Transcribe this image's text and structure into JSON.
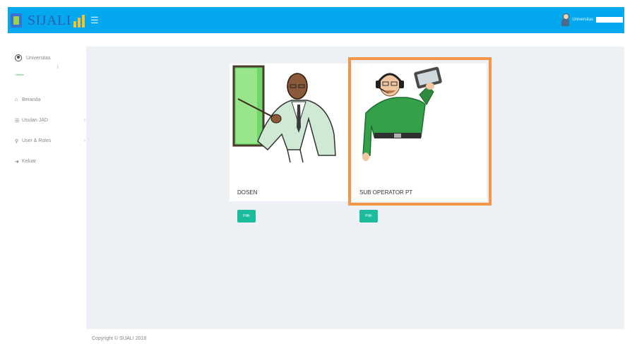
{
  "app": {
    "logo_text": "SIJALI"
  },
  "topbar": {
    "menu_icon": "hamburger-icon",
    "user_name": "Universitas"
  },
  "sidebar": {
    "user": {
      "name": "Universitas",
      "status": "Online",
      "mark": "I"
    },
    "items": [
      {
        "label": "Beranda",
        "icon": "home-icon",
        "has_children": false
      },
      {
        "label": "Usulan JAD",
        "icon": "list-icon",
        "has_children": true
      },
      {
        "label": "User & Roles",
        "icon": "key-icon",
        "has_children": true
      },
      {
        "label": "Keluar",
        "icon": "logout-icon",
        "has_children": false
      }
    ]
  },
  "cards": [
    {
      "title": "DOSEN",
      "button": "Pilih",
      "image": "lecturer-illustration"
    },
    {
      "title": "SUB OPERATOR PT",
      "button": "Pilih",
      "image": "operator-illustration"
    }
  ],
  "footer": {
    "copyright": "Copyright © SIJALI 2018"
  },
  "colors": {
    "topbar": "#04a8ef",
    "button": "#1abc9c",
    "highlight": "#f5954a",
    "content_bg": "#edf0f5"
  }
}
